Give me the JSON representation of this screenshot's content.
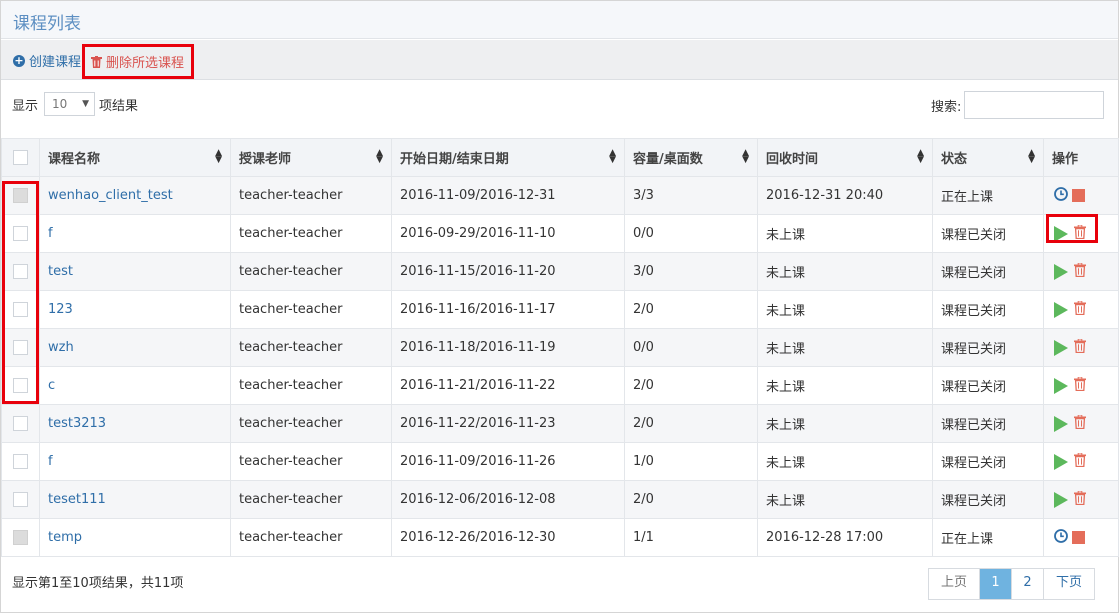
{
  "header": {
    "title": "课程列表"
  },
  "toolbar": {
    "create_label": "创建课程",
    "delete_label": "删除所选课程"
  },
  "controls": {
    "show_label": "显示",
    "page_length": "10",
    "show_suffix": "项结果",
    "search_label": "搜索:",
    "search_value": ""
  },
  "table": {
    "columns": [
      "课程名称",
      "授课老师",
      "开始日期/结束日期",
      "容量/桌面数",
      "回收时间",
      "状态",
      "操作"
    ],
    "rows": [
      {
        "name": "wenhao_client_test",
        "teacher": "teacher-teacher",
        "dates": "2016-11-09/2016-12-31",
        "capacity": "3/3",
        "recycle": "2016-12-31 20:40",
        "status": "正在上课",
        "actions": [
          "clock-icon",
          "stop-icon"
        ],
        "checkbox_disabled": true
      },
      {
        "name": "f",
        "teacher": "teacher-teacher",
        "dates": "2016-09-29/2016-11-10",
        "capacity": "0/0",
        "recycle": "未上课",
        "status": "课程已关闭",
        "actions": [
          "play-icon",
          "trash-icon"
        ],
        "checkbox_disabled": false
      },
      {
        "name": "test",
        "teacher": "teacher-teacher",
        "dates": "2016-11-15/2016-11-20",
        "capacity": "3/0",
        "recycle": "未上课",
        "status": "课程已关闭",
        "actions": [
          "play-icon",
          "trash-icon"
        ],
        "checkbox_disabled": false
      },
      {
        "name": "123",
        "teacher": "teacher-teacher",
        "dates": "2016-11-16/2016-11-17",
        "capacity": "2/0",
        "recycle": "未上课",
        "status": "课程已关闭",
        "actions": [
          "play-icon",
          "trash-icon"
        ],
        "checkbox_disabled": false
      },
      {
        "name": "wzh",
        "teacher": "teacher-teacher",
        "dates": "2016-11-18/2016-11-19",
        "capacity": "0/0",
        "recycle": "未上课",
        "status": "课程已关闭",
        "actions": [
          "play-icon",
          "trash-icon"
        ],
        "checkbox_disabled": false
      },
      {
        "name": "c",
        "teacher": "teacher-teacher",
        "dates": "2016-11-21/2016-11-22",
        "capacity": "2/0",
        "recycle": "未上课",
        "status": "课程已关闭",
        "actions": [
          "play-icon",
          "trash-icon"
        ],
        "checkbox_disabled": false
      },
      {
        "name": "test3213",
        "teacher": "teacher-teacher",
        "dates": "2016-11-22/2016-11-23",
        "capacity": "2/0",
        "recycle": "未上课",
        "status": "课程已关闭",
        "actions": [
          "play-icon",
          "trash-icon"
        ],
        "checkbox_disabled": false
      },
      {
        "name": "f",
        "teacher": "teacher-teacher",
        "dates": "2016-11-09/2016-11-26",
        "capacity": "1/0",
        "recycle": "未上课",
        "status": "课程已关闭",
        "actions": [
          "play-icon",
          "trash-icon"
        ],
        "checkbox_disabled": false
      },
      {
        "name": "teset111",
        "teacher": "teacher-teacher",
        "dates": "2016-12-06/2016-12-08",
        "capacity": "2/0",
        "recycle": "未上课",
        "status": "课程已关闭",
        "actions": [
          "play-icon",
          "trash-icon"
        ],
        "checkbox_disabled": false
      },
      {
        "name": "temp",
        "teacher": "teacher-teacher",
        "dates": "2016-12-26/2016-12-30",
        "capacity": "1/1",
        "recycle": "2016-12-28 17:00",
        "status": "正在上课",
        "actions": [
          "clock-icon",
          "stop-icon"
        ],
        "checkbox_disabled": true
      }
    ]
  },
  "footer": {
    "info": "显示第1至10项结果，共11项",
    "prev_label": "上页",
    "pages": [
      "1",
      "2"
    ],
    "active_page": "1",
    "next_label": "下页"
  },
  "colors": {
    "accent": "#2f6ea8",
    "highlight": "#e8000b",
    "play": "#5cb85c",
    "danger": "#e46d5a",
    "active_page": "#6fb3e0"
  }
}
